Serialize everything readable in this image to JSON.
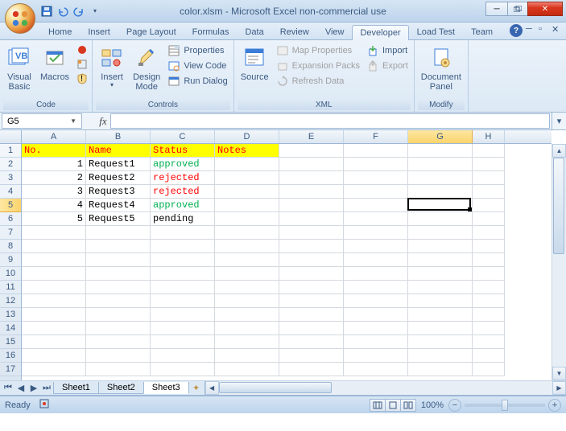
{
  "window": {
    "title": "color.xlsm - Microsoft Excel non-commercial use"
  },
  "qat": {
    "save": "",
    "undo": "",
    "redo": ""
  },
  "tabs": {
    "items": [
      "Home",
      "Insert",
      "Page Layout",
      "Formulas",
      "Data",
      "Review",
      "View",
      "Developer",
      "Load Test",
      "Team"
    ],
    "active": "Developer"
  },
  "ribbon": {
    "code": {
      "label": "Code",
      "visual_basic": "Visual\nBasic",
      "macros": "Macros"
    },
    "controls": {
      "label": "Controls",
      "insert": "Insert",
      "design": "Design\nMode",
      "properties": "Properties",
      "view_code": "View Code",
      "run_dialog": "Run Dialog"
    },
    "xml": {
      "label": "XML",
      "source": "Source",
      "map_props": "Map Properties",
      "expansion": "Expansion Packs",
      "refresh": "Refresh Data",
      "import": "Import",
      "export": "Export"
    },
    "modify": {
      "label": "Modify",
      "panel": "Document\nPanel"
    }
  },
  "namebox": {
    "value": "G5"
  },
  "formula": {
    "value": ""
  },
  "cols": [
    "A",
    "B",
    "C",
    "D",
    "E",
    "F",
    "G",
    "H"
  ],
  "rows": [
    "1",
    "2",
    "3",
    "4",
    "5",
    "6",
    "7",
    "8",
    "9",
    "10",
    "11",
    "12",
    "13",
    "14",
    "15",
    "16",
    "17"
  ],
  "active_cell": {
    "col": "G",
    "row": "5"
  },
  "sheet_data": {
    "header": {
      "a": "No.",
      "b": "Name",
      "c": "Status",
      "d": "Notes"
    },
    "rows": [
      {
        "no": "1",
        "name": "Request1",
        "status": "approved",
        "status_class": "approved"
      },
      {
        "no": "2",
        "name": "Request2",
        "status": "rejected",
        "status_class": "rejected"
      },
      {
        "no": "3",
        "name": "Request3",
        "status": "rejected",
        "status_class": "rejected"
      },
      {
        "no": "4",
        "name": "Request4",
        "status": "approved",
        "status_class": "approved"
      },
      {
        "no": "5",
        "name": "Request5",
        "status": "pending",
        "status_class": ""
      }
    ]
  },
  "sheets": {
    "items": [
      "Sheet1",
      "Sheet2",
      "Sheet3"
    ],
    "active": "Sheet3"
  },
  "status": {
    "ready": "Ready",
    "zoom": "100%"
  }
}
